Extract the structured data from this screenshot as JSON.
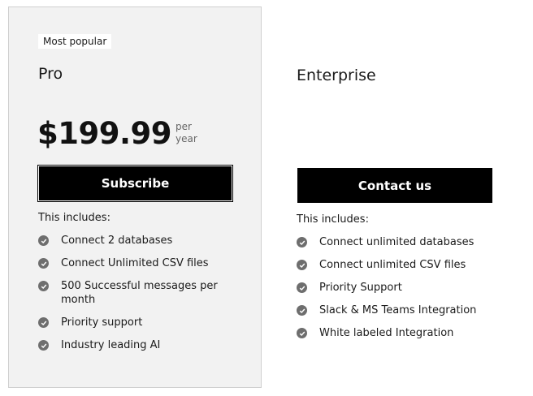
{
  "plans": [
    {
      "badge": "Most popular",
      "name": "Pro",
      "price": "$199.99",
      "period_line1": "per",
      "period_line2": "year",
      "button_label": "Subscribe",
      "includes_label": "This includes:",
      "features": [
        "Connect 2 databases",
        "Connect Unlimited CSV files",
        "500 Successful messages per month",
        "Priority support",
        "Industry leading AI"
      ]
    },
    {
      "name": "Enterprise",
      "button_label": "Contact us",
      "includes_label": "This includes:",
      "features": [
        "Connect unlimited databases",
        "Connect unlimited CSV files",
        "Priority Support",
        "Slack & MS Teams Integration",
        "White labeled Integration"
      ]
    }
  ],
  "icons": {
    "feature_check": "check-circle-icon"
  },
  "colors": {
    "highlight_card_bg": "#f2f2f2",
    "button_bg": "#000000",
    "button_text": "#ffffff",
    "check_icon": "#6e6e6e"
  }
}
